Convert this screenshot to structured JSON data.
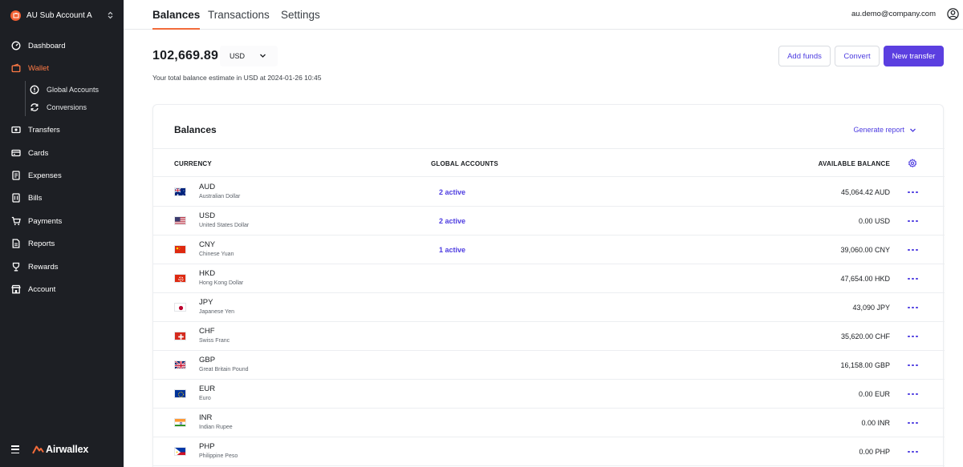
{
  "sidebar": {
    "account_name": "AU Sub Account A",
    "nav": [
      {
        "label": "Dashboard",
        "icon": "dashboard-icon"
      },
      {
        "label": "Wallet",
        "icon": "wallet-icon",
        "active": true
      },
      {
        "label": "Transfers",
        "icon": "transfers-icon"
      },
      {
        "label": "Cards",
        "icon": "cards-icon"
      },
      {
        "label": "Expenses",
        "icon": "expenses-icon"
      },
      {
        "label": "Bills",
        "icon": "bills-icon"
      },
      {
        "label": "Payments",
        "icon": "payments-icon"
      },
      {
        "label": "Reports",
        "icon": "reports-icon"
      },
      {
        "label": "Rewards",
        "icon": "rewards-icon"
      },
      {
        "label": "Account",
        "icon": "account-icon"
      }
    ],
    "sub_nav": [
      {
        "label": "Global Accounts",
        "icon": "globe-icon"
      },
      {
        "label": "Conversions",
        "icon": "conversions-icon"
      }
    ],
    "logo_text": "Airwallex"
  },
  "topbar": {
    "tabs": [
      {
        "label": "Balances",
        "active": true
      },
      {
        "label": "Transactions"
      },
      {
        "label": "Settings"
      }
    ],
    "user_email": "au.demo@company.com"
  },
  "header": {
    "total_balance": "102,669.89",
    "currency": "USD",
    "note": "Your total balance estimate in USD at 2024-01-26 10:45",
    "buttons": {
      "add_funds": "Add funds",
      "convert": "Convert",
      "new_transfer": "New transfer"
    }
  },
  "balances": {
    "title": "Balances",
    "generate_report": "Generate report",
    "columns": {
      "currency": "CURRENCY",
      "global_accounts": "GLOBAL ACCOUNTS",
      "available_balance": "AVAILABLE BALANCE"
    },
    "rows": [
      {
        "code": "AUD",
        "name": "Australian Dollar",
        "global_accounts": "2 active",
        "balance": "45,064.42 AUD"
      },
      {
        "code": "USD",
        "name": "United States Dollar",
        "global_accounts": "2 active",
        "balance": "0.00 USD"
      },
      {
        "code": "CNY",
        "name": "Chinese Yuan",
        "global_accounts": "1 active",
        "balance": "39,060.00 CNY"
      },
      {
        "code": "HKD",
        "name": "Hong Kong Dollar",
        "global_accounts": "",
        "balance": "47,654.00 HKD"
      },
      {
        "code": "JPY",
        "name": "Japanese Yen",
        "global_accounts": "",
        "balance": "43,090 JPY"
      },
      {
        "code": "CHF",
        "name": "Swiss Franc",
        "global_accounts": "",
        "balance": "35,620.00 CHF"
      },
      {
        "code": "GBP",
        "name": "Great Britain Pound",
        "global_accounts": "",
        "balance": "16,158.00 GBP"
      },
      {
        "code": "EUR",
        "name": "Euro",
        "global_accounts": "",
        "balance": "0.00 EUR"
      },
      {
        "code": "INR",
        "name": "Indian Rupee",
        "global_accounts": "",
        "balance": "0.00 INR"
      },
      {
        "code": "PHP",
        "name": "Philippine Peso",
        "global_accounts": "",
        "balance": "0.00 PHP"
      }
    ]
  },
  "colors": {
    "sidebar_bg": "#1d1f24",
    "accent_orange": "#f26b3a",
    "primary_purple": "#5b3fe0",
    "link_purple": "#4c3be0"
  }
}
